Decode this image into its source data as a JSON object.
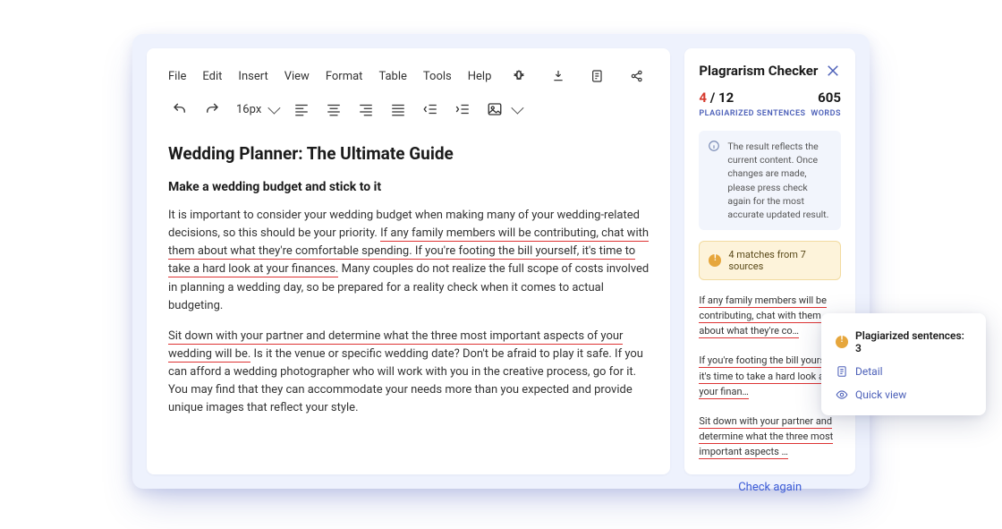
{
  "menubar": {
    "file": "File",
    "edit": "Edit",
    "insert": "Insert",
    "view": "View",
    "format": "Format",
    "table": "Table",
    "tools": "Tools",
    "help": "Help"
  },
  "toolbar": {
    "font_size": "16px"
  },
  "doc": {
    "title": "Wedding Planner: The Ultimate Guide",
    "subtitle": "Make a wedding budget and stick to it",
    "p1a": "It is important to consider your wedding budget when making many of your wedding-related decisions, so this should be your priority. ",
    "p1b": "If any family members will be contributing, chat with them about what they're comfortable spending. If you're footing the bill yourself, it's time to take a hard look at your finances.",
    "p1c": " Many couples do not realize the full scope of costs involved in planning a wedding day, so be prepared for a reality check when it comes to actual budgeting.",
    "p2a": "Sit down with your partner and determine what the three most important aspects of your wedding will be.",
    "p2b": " Is it the venue or specific wedding date? Don't be afraid to play it safe. If you can afford a wedding photographer who will work with you in the creative process, go for it. You may find that they can accommodate your needs more than you expected and provide unique images that reflect your style."
  },
  "checker": {
    "title": "Plagrarism Checker",
    "plag_count": "4",
    "plag_sep": " / ",
    "plag_total": "12",
    "plag_label": "PLAGIARIZED SENTENCES",
    "words_count": "605",
    "words_label": "WORDS",
    "info": "The result reflects the current content. Once changes are made, please press check again for the most accurate updated result.",
    "warn": "4 matches from 7 sources",
    "snip1": "If any family members will be contributing, chat with them about what they're co…",
    "snip2": "If you're footing the bill yourself, it's time to take a hard look at your finan…",
    "snip3": "Sit down with your partner and determine what the three most important aspects …",
    "check_again": "Check again"
  },
  "popup": {
    "head": "Plagiarized sentences: 3",
    "detail": "Detail",
    "quick": "Quick view"
  }
}
